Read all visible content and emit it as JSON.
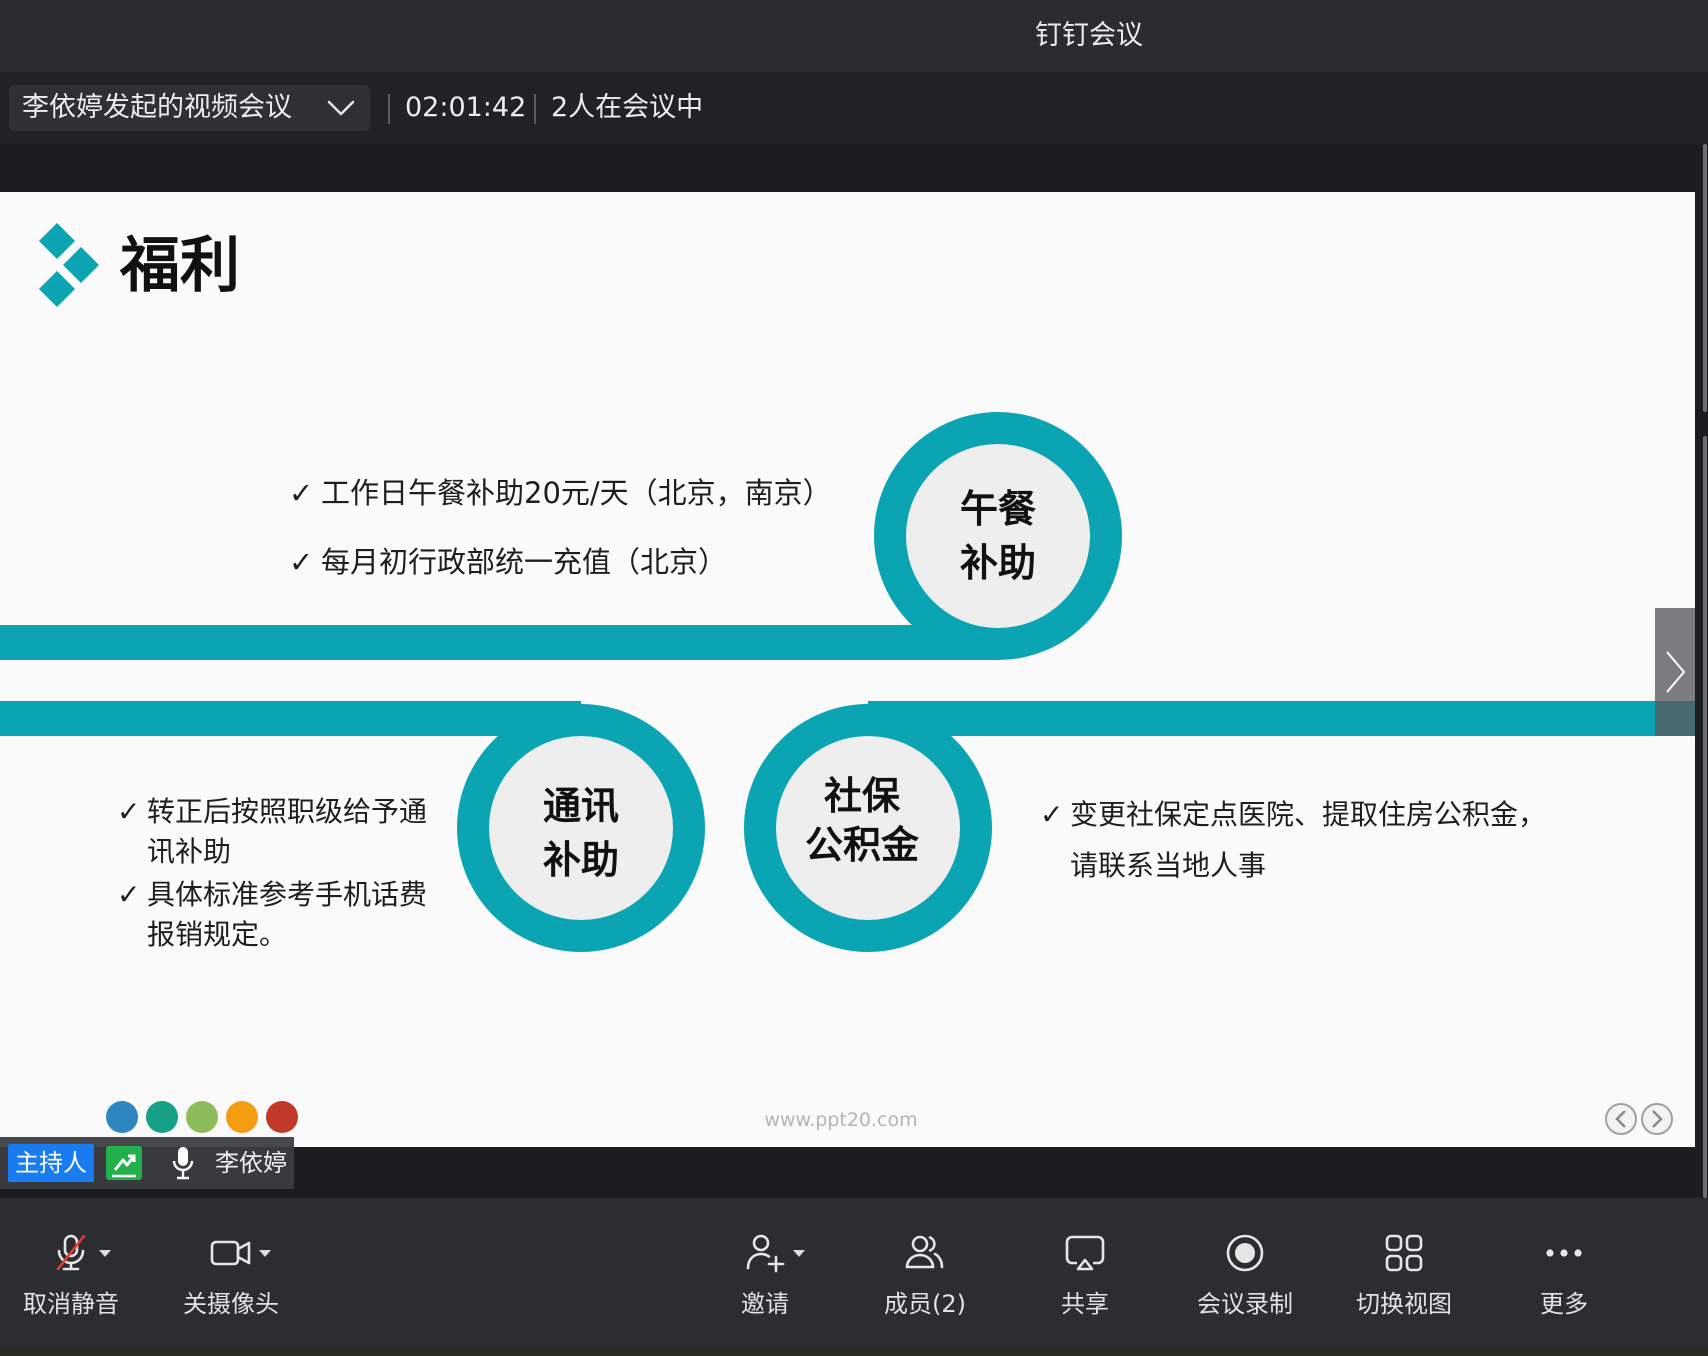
{
  "window": {
    "title": "钉钉会议"
  },
  "meeting": {
    "name": "李依婷发起的视频会议",
    "duration": "02:01:42",
    "participants": "2人在会议中",
    "dropdown_icon": "chevron-down-icon"
  },
  "slide": {
    "title": "福利",
    "logo_icon": "diamond-logo-icon",
    "bullet_marker": "✓",
    "lunch": {
      "label_line1": "午餐",
      "label_line2": "补助",
      "bullets": [
        "工作日午餐补助20元/天（北京，南京）",
        "每月初行政部统一充值（北京）"
      ]
    },
    "communication": {
      "label_line1": "通讯",
      "label_line2": "补助",
      "bullets": [
        "转正后按照职级给予通讯补助",
        "具体标准参考手机话费报销规定。"
      ]
    },
    "social_security": {
      "label_line1": "社保",
      "label_line2": "公积金",
      "bullets": [
        "变更社保定点医院、提取住房公积金，请联系当地人事"
      ]
    },
    "watermark": "www.ppt20.com",
    "dot_colors": [
      "#2e86c1",
      "#16a085",
      "#8fbc5a",
      "#f39c12",
      "#c0392b"
    ],
    "nav_icons": [
      "chevron-left-circle-icon",
      "chevron-right-circle-icon"
    ],
    "next_page_icon": "chevron-right-icon"
  },
  "speaker": {
    "role_badge": "主持人",
    "name": "李依婷",
    "status_icon": "screen-share-status-icon",
    "mic_icon": "microphone-icon"
  },
  "toolbar": {
    "mute": {
      "label": "取消静音",
      "icon": "microphone-muted-icon"
    },
    "camera": {
      "label": "关摄像头",
      "icon": "video-camera-icon"
    },
    "invite": {
      "label": "邀请",
      "icon": "add-user-icon"
    },
    "members": {
      "label": "成员(2)",
      "icon": "members-icon"
    },
    "share": {
      "label": "共享",
      "icon": "screen-share-icon"
    },
    "record": {
      "label": "会议录制",
      "icon": "record-icon"
    },
    "switch_view": {
      "label": "切换视图",
      "icon": "grid-view-icon"
    },
    "more": {
      "label": "更多",
      "icon": "more-dots-icon"
    }
  },
  "colors": {
    "accent": "#0aa4b3",
    "circle_fill": "#eeeeee",
    "host_badge": "#1b7cf2",
    "muted_slash": "#e53935",
    "status_green": "#22b04b",
    "slide_background": "#fafafa"
  }
}
